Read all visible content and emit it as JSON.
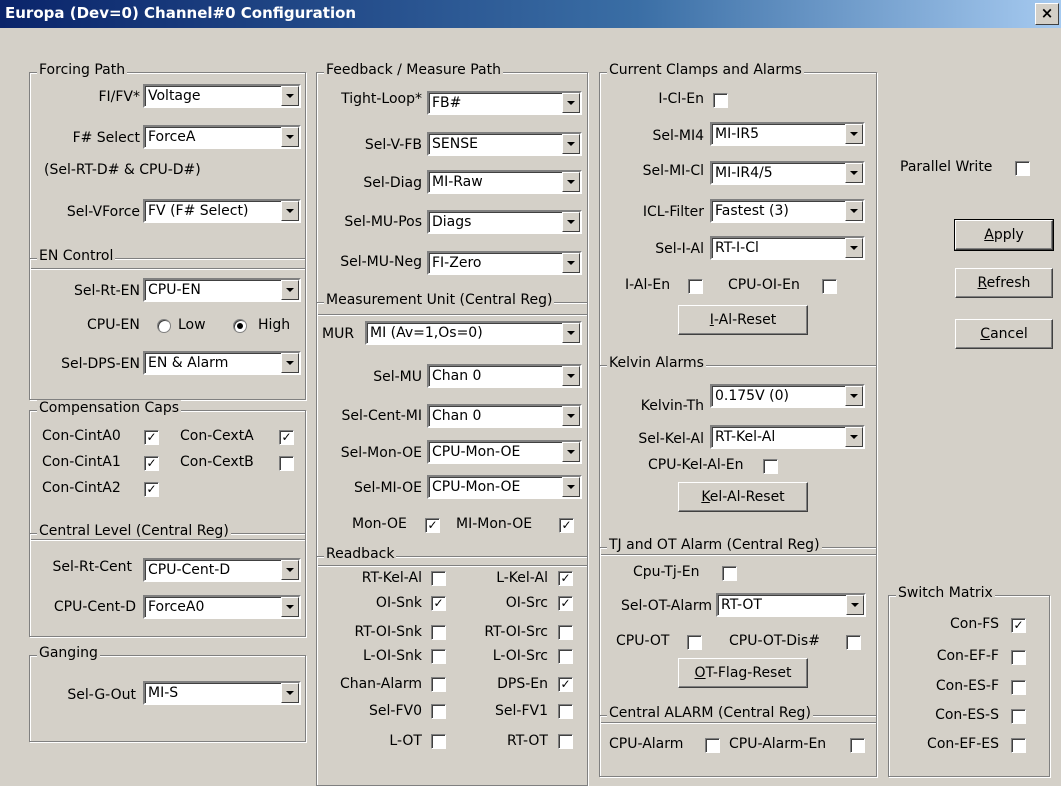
{
  "window": {
    "title": "Europa (Dev=0) Channel#0 Configuration",
    "close": "×"
  },
  "forcing": {
    "title": "Forcing Path",
    "fifv_label": "FI/FV*",
    "fifv_value": "Voltage",
    "fsel_label": "F# Select",
    "fsel_value": "ForceA",
    "note": "(Sel-RT-D# & CPU-D#)",
    "vforce_label": "Sel-VForce",
    "vforce_value": "FV (F# Select)"
  },
  "en": {
    "title": "EN Control",
    "rten_label": "Sel-Rt-EN",
    "rten_value": "CPU-EN",
    "cpuen_label": "CPU-EN",
    "low": "Low",
    "high": "High",
    "dpsen_label": "Sel-DPS-EN",
    "dpsen_value": "EN & Alarm"
  },
  "comp": {
    "title": "Compensation Caps",
    "a0": "Con-CintA0",
    "a1": "Con-CintA1",
    "a2": "Con-CintA2",
    "ca": "Con-CextA",
    "cb": "Con-CextB",
    "check": "✓"
  },
  "central": {
    "title": "Central Level (Central Reg)",
    "rtcent_label": "Sel-Rt-Cent",
    "rtcent_value": "CPU-Cent-D",
    "cpucent_label": "CPU-Cent-D",
    "cpucent_value": "ForceA0"
  },
  "ganging": {
    "title": "Ganging",
    "gout_label": "Sel-G-Out",
    "gout_value": "MI-S"
  },
  "feedback": {
    "title": "Feedback / Measure Path",
    "tl_label": "Tight-Loop*",
    "tl_value": "FB#",
    "vfb_label": "Sel-V-FB",
    "vfb_value": "SENSE",
    "diag_label": "Sel-Diag",
    "diag_value": "MI-Raw",
    "mupos_label": "Sel-MU-Pos",
    "mupos_value": "Diags",
    "muneg_label": "Sel-MU-Neg",
    "muneg_value": "FI-Zero"
  },
  "mu": {
    "title": "Measurement Unit (Central Reg)",
    "mur_label": "MUR",
    "mur_value": "MI (Av=1,Os=0)",
    "selmu_label": "Sel-MU",
    "selmu_value": "Chan 0",
    "centmi_label": "Sel-Cent-MI",
    "centmi_value": "Chan 0",
    "monoe_label": "Sel-Mon-OE",
    "monoe_value": "CPU-Mon-OE",
    "mioe_label": "Sel-MI-OE",
    "mioe_value": "CPU-Mon-OE",
    "monoe_cb": "Mon-OE",
    "mimonoe_cb": "MI-Mon-OE"
  },
  "readback": {
    "title": "Readback",
    "rtkel": "RT-Kel-Al",
    "lkel": "L-Kel-Al",
    "oisnk": "OI-Snk",
    "oisrc": "OI-Src",
    "rtoisnk": "RT-OI-Snk",
    "rtoisrc": "RT-OI-Src",
    "loisnk": "L-OI-Snk",
    "loisrc": "L-OI-Src",
    "chanalarm": "Chan-Alarm",
    "dpsen": "DPS-En",
    "selfv0": "Sel-FV0",
    "selfv1": "Sel-FV1",
    "lot": "L-OT",
    "rtot": "RT-OT"
  },
  "clamps": {
    "title": "Current Clamps and Alarms",
    "iclen": "I-Cl-En",
    "mi4_label": "Sel-MI4",
    "mi4_value": "MI-IR5",
    "micl_label": "Sel-MI-Cl",
    "micl_value": "MI-IR4/5",
    "icl_label": "ICL-Filter",
    "icl_value": "Fastest (3)",
    "ial_label": "Sel-I-Al",
    "ial_value": "RT-I-Cl",
    "ialen": "I-Al-En",
    "cpuoien": "CPU-OI-En",
    "reset_u": "I",
    "reset_rest": "-Al-Reset"
  },
  "kelvin": {
    "title": "Kelvin Alarms",
    "th_label": "Kelvin-Th",
    "th_value": "0.175V (0)",
    "kel_label": "Sel-Kel-Al",
    "kel_value": "RT-Kel-Al",
    "cpukelen": "CPU-Kel-Al-En",
    "reset_u": "K",
    "reset_rest": "el-Al-Reset"
  },
  "tj": {
    "title": "TJ and OT Alarm (Central Reg)",
    "cputjen": "Cpu-Tj-En",
    "ot_label": "Sel-OT-Alarm",
    "ot_value": "RT-OT",
    "cpuot": "CPU-OT",
    "cpuotdis": "CPU-OT-Dis#",
    "reset_u": "O",
    "reset_rest": "T-Flag-Reset"
  },
  "alarm": {
    "title": "Central ALARM (Central Reg)",
    "cpualarm": "CPU-Alarm",
    "cpualarmen": "CPU-Alarm-En"
  },
  "right": {
    "parallel": "Parallel Write",
    "apply_u": "A",
    "apply_rest": "pply",
    "refresh_u": "R",
    "refresh_rest": "efresh",
    "cancel_u": "C",
    "cancel_rest": "ancel"
  },
  "switch": {
    "title": "Switch Matrix",
    "fs": "Con-FS",
    "eff": "Con-EF-F",
    "esf": "Con-ES-F",
    "ess": "Con-ES-S",
    "efes": "Con-EF-ES"
  }
}
